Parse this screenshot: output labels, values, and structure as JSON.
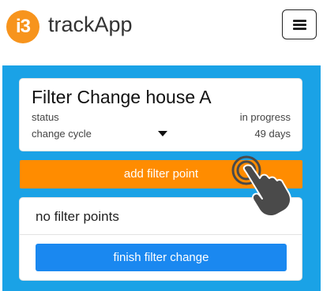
{
  "header": {
    "logo_text": "i3",
    "app_name": "trackApp",
    "menu_icon": "hamburger-icon"
  },
  "filter_card": {
    "title": "Filter Change house A",
    "status_label": "status",
    "status_value": "in progress",
    "cycle_label": "change cycle",
    "cycle_value": "49 days"
  },
  "actions": {
    "add_filter_point": "add filter point"
  },
  "filter_points": {
    "empty_text": "no filter points",
    "finish_button": "finish filter change"
  },
  "colors": {
    "panel": "#1aa2e6",
    "add_button": "#ff8c00",
    "finish_button": "#1a88f0",
    "logo": "#f7941d"
  },
  "pointer_icon": "tap-hand-icon"
}
